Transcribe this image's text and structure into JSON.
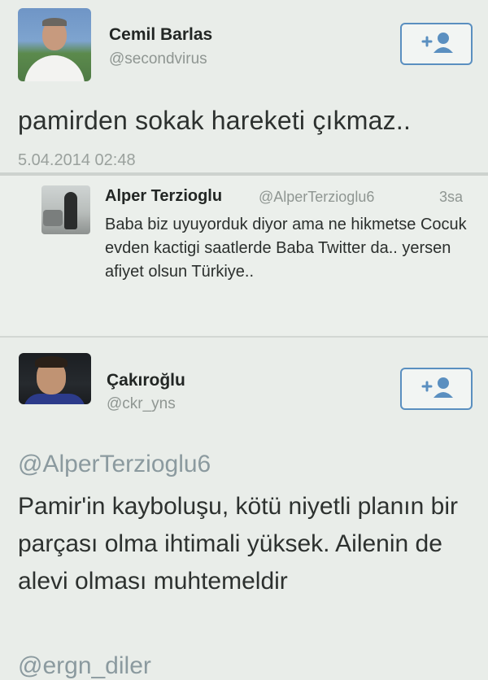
{
  "tweet1": {
    "name": "Cemil Barlas",
    "handle": "@secondvirus",
    "text": "pamirden sokak hareketi çıkmaz..",
    "date": "5.04.2014 02:48"
  },
  "quoted": {
    "name": "Alper Terzioglu",
    "handle": "@AlperTerzioglu6",
    "time": "3sa",
    "text": "Baba biz uyuyorduk diyor ama ne hikmetse Cocuk evden kactigi saatlerde Baba Twitter da.. yersen afiyet olsun Türkiye.."
  },
  "tweet2": {
    "name": "Çakıroğlu",
    "handle": "@ckr_yns",
    "mention_top": "@AlperTerzioglu6",
    "text": "Pamir'in kayboluşu, kötü niyetli planın bir parçası olma ihtimali yüksek. Ailenin de alevi olması muhtemeldir",
    "mention_bottom": "@ergn_diler"
  },
  "icons": {
    "follow": "add-user-icon"
  },
  "colors": {
    "background": "#e9ede9",
    "follow_border": "#5a8fc0",
    "mention": "#8b9a9f"
  }
}
